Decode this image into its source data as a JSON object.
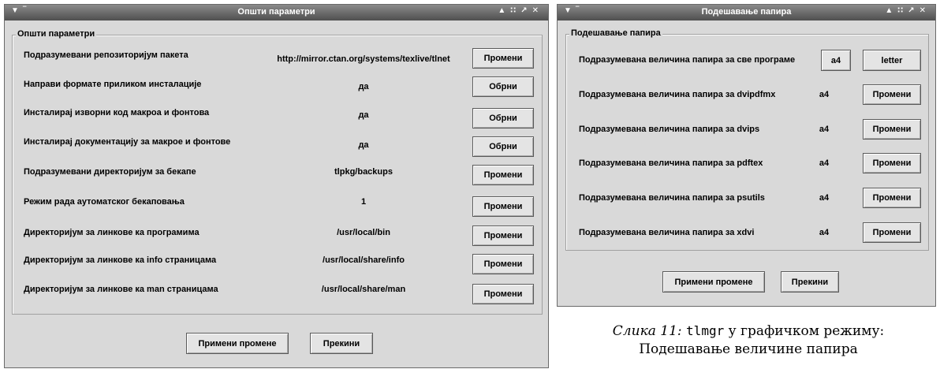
{
  "general_window": {
    "title": "Општи параметри",
    "group_title": "Општи параметри",
    "rows": [
      {
        "label": "Подразумевани репозиторијум пакета",
        "value": "http://mirror.ctan.org/systems/texlive/tlnet",
        "button": "Промени"
      },
      {
        "label": "Направи формате приликом инсталације",
        "value": "да",
        "button": "Обрни"
      },
      {
        "label": "Инсталирај изворни код макроа и фонтова",
        "value": "да",
        "button": "Обрни"
      },
      {
        "label": "Инсталирај документацију за макрое и фонтове",
        "value": "да",
        "button": "Обрни"
      },
      {
        "label": "Подразумевани директоријум за бекапе",
        "value": "tlpkg/backups",
        "button": "Промени"
      },
      {
        "label": "Режим рада аутоматског бекаповања",
        "value": "1",
        "button": "Промени"
      },
      {
        "label": "Директоријум за линкове ка програмима",
        "value": "/usr/local/bin",
        "button": "Промени"
      },
      {
        "label": "Директоријум за линкове ка info страницама",
        "value": "/usr/local/share/info",
        "button": "Промени"
      },
      {
        "label": "Директоријум за линкове ка man страницама",
        "value": "/usr/local/share/man",
        "button": "Промени"
      }
    ],
    "apply_button": "Примени промене",
    "cancel_button": "Прекини"
  },
  "paper_window": {
    "title": "Подешавање папира",
    "group_title": "Подешавање папира",
    "all_row": {
      "label": "Подразумевана величина папира за све програме",
      "a4_button": "a4",
      "letter_button": "letter"
    },
    "rows": [
      {
        "label": "Подразумевана величина папира за dvipdfmx",
        "value": "a4",
        "button": "Промени"
      },
      {
        "label": "Подразумевана величина папира за dvips",
        "value": "a4",
        "button": "Промени"
      },
      {
        "label": "Подразумевана величина папира за pdftex",
        "value": "a4",
        "button": "Промени"
      },
      {
        "label": "Подразумевана величина папира за psutils",
        "value": "a4",
        "button": "Промени"
      },
      {
        "label": "Подразумевана величина папира за xdvi",
        "value": "a4",
        "button": "Промени"
      }
    ],
    "apply_button": "Примени промене",
    "cancel_button": "Прекини"
  },
  "titlebar_icons": {
    "left": [
      "menu-arrow-icon",
      "minimize-dash-icon"
    ],
    "right": [
      "shade-up-icon",
      "sticky-dots-icon",
      "maximize-icon",
      "close-icon"
    ]
  },
  "caption": {
    "label": "Слика 11:",
    "program": "tlmgr",
    "line1_rest": "у графичком режиму:",
    "line2": "Подешавање величине папира"
  }
}
